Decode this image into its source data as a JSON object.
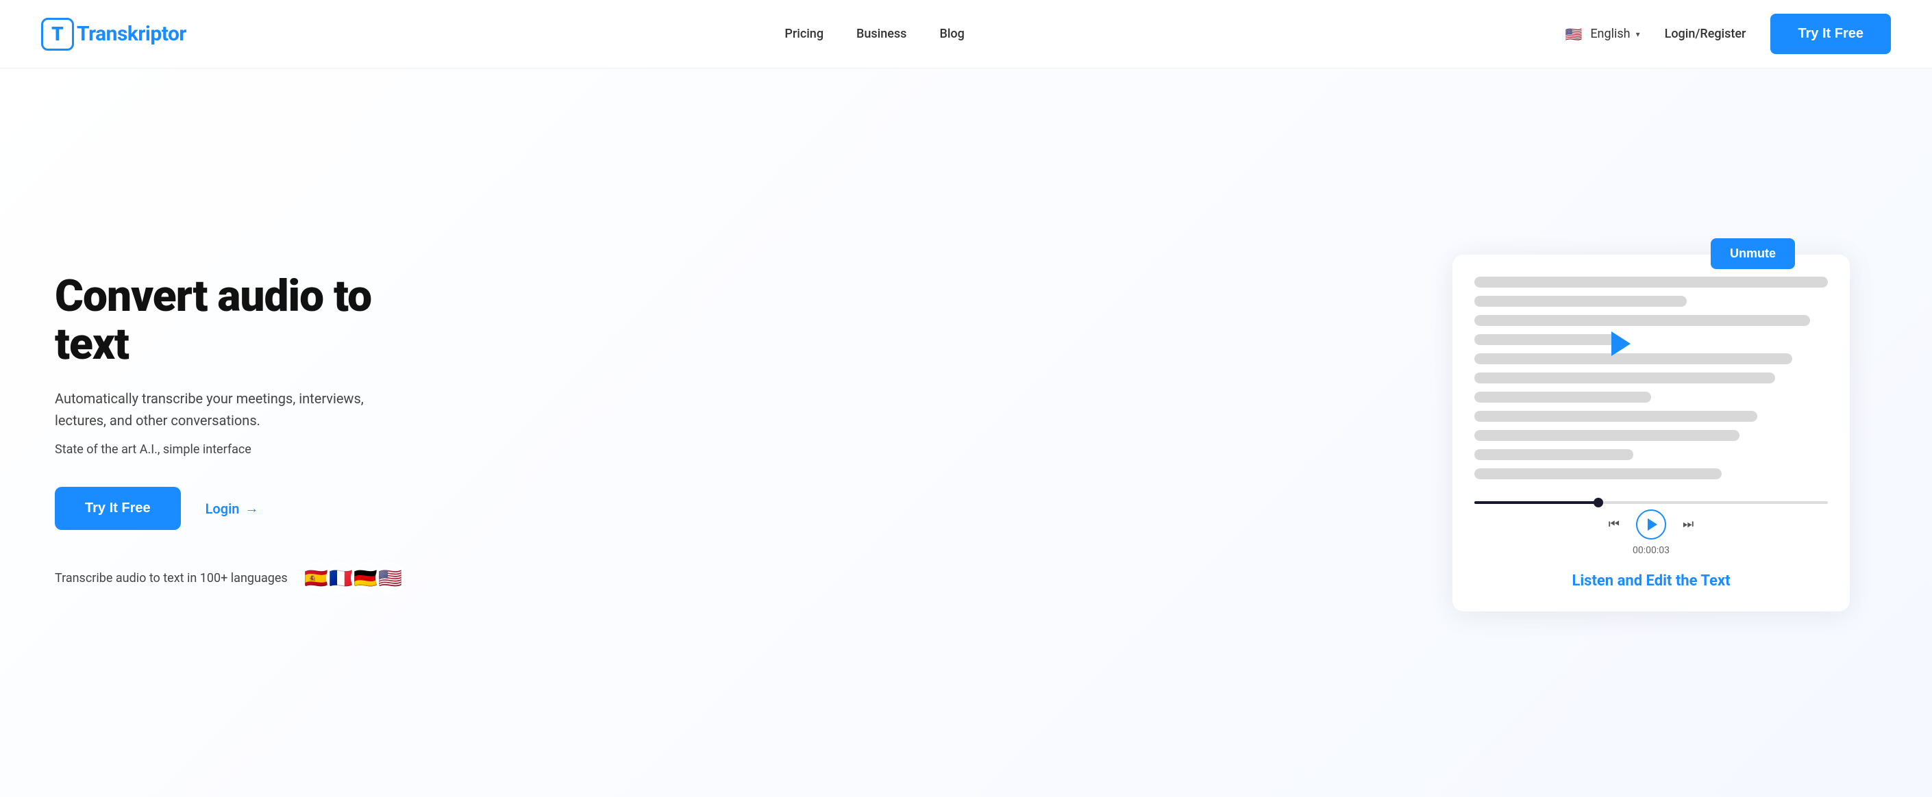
{
  "brand": {
    "name": "Transkriptor",
    "logo_letter": "T"
  },
  "nav": {
    "links": [
      {
        "label": "Pricing",
        "id": "pricing"
      },
      {
        "label": "Business",
        "id": "business"
      },
      {
        "label": "Blog",
        "id": "blog"
      }
    ],
    "language": {
      "label": "English",
      "flag": "🇺🇸",
      "chevron": "▾"
    },
    "login_label": "Login/Register",
    "try_btn_label": "Try It Free"
  },
  "hero": {
    "title": "Convert audio to text",
    "subtitle": "Automatically transcribe your meetings, interviews, lectures, and other conversations.",
    "tagline": "State of the art A.I., simple interface",
    "try_btn_label": "Try It Free",
    "login_label": "Login",
    "login_arrow": "→",
    "languages_text": "Transcribe audio to text in 100+ languages",
    "flags": [
      "🇪🇸",
      "🇫🇷",
      "🇩🇪",
      "🇺🇸"
    ]
  },
  "player": {
    "unmute_label": "Unmute",
    "listen_edit_label": "Listen and Edit the Text",
    "time": "00:00:03"
  }
}
